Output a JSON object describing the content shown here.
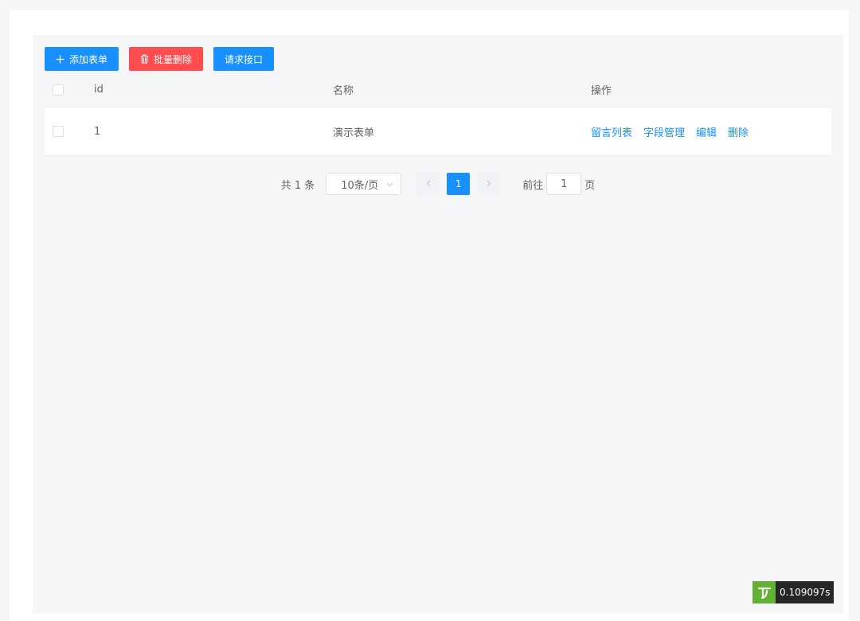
{
  "toolbar": {
    "add_label": "添加表单",
    "batch_delete_label": "批量删除",
    "request_label": "请求接口"
  },
  "table": {
    "headers": {
      "id": "id",
      "name": "名称",
      "ops": "操作"
    },
    "rows": [
      {
        "id": "1",
        "name": "演示表单",
        "ops": [
          "留言列表",
          "字段管理",
          "编辑",
          "删除"
        ]
      }
    ]
  },
  "pagination": {
    "total": "共 1 条",
    "page_size": "10条/页",
    "current_page": "1",
    "goto_prefix": "前往",
    "goto_value": "1",
    "goto_suffix": "页"
  },
  "trace": {
    "time": "0.109097s"
  },
  "colors": {
    "primary": "#1890ff",
    "danger": "#ff4d4f",
    "badge_green": "#63b134",
    "badge_dark": "#262626"
  }
}
